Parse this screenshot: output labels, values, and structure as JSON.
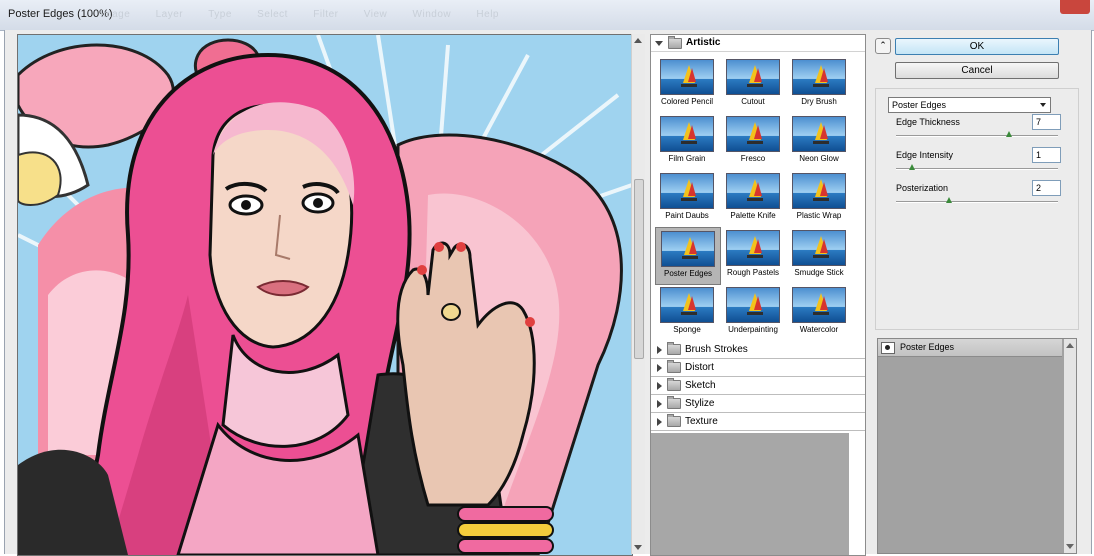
{
  "window": {
    "title": "Poster Edges (100%)",
    "background_menu": [
      "Image",
      "Layer",
      "Type",
      "Select",
      "Filter",
      "View",
      "Window",
      "Help"
    ]
  },
  "gallery": {
    "open_category": "Artistic",
    "artistic_filters": [
      {
        "label": "Colored Pencil",
        "selected": false
      },
      {
        "label": "Cutout",
        "selected": false
      },
      {
        "label": "Dry Brush",
        "selected": false
      },
      {
        "label": "Film Grain",
        "selected": false
      },
      {
        "label": "Fresco",
        "selected": false
      },
      {
        "label": "Neon Glow",
        "selected": false
      },
      {
        "label": "Paint Daubs",
        "selected": false
      },
      {
        "label": "Palette Knife",
        "selected": false
      },
      {
        "label": "Plastic Wrap",
        "selected": false
      },
      {
        "label": "Poster Edges",
        "selected": true
      },
      {
        "label": "Rough Pastels",
        "selected": false
      },
      {
        "label": "Smudge Stick",
        "selected": false
      },
      {
        "label": "Sponge",
        "selected": false
      },
      {
        "label": "Underpainting",
        "selected": false
      },
      {
        "label": "Watercolor",
        "selected": false
      }
    ],
    "closed_categories": [
      "Brush Strokes",
      "Distort",
      "Sketch",
      "Stylize",
      "Texture"
    ]
  },
  "buttons": {
    "ok": "OK",
    "cancel": "Cancel"
  },
  "settings": {
    "filter_select": "Poster Edges",
    "params": [
      {
        "label": "Edge Thickness",
        "value": "7",
        "fraction": 0.7
      },
      {
        "label": "Edge Intensity",
        "value": "1",
        "fraction": 0.1
      },
      {
        "label": "Posterization",
        "value": "2",
        "fraction": 0.33
      }
    ]
  },
  "layers": {
    "items": [
      "Poster Edges"
    ]
  },
  "colors": {
    "ok_accent": "#3c7fb1",
    "hijab_pink": "#ec4f93",
    "sky": "#9fd3ef"
  }
}
